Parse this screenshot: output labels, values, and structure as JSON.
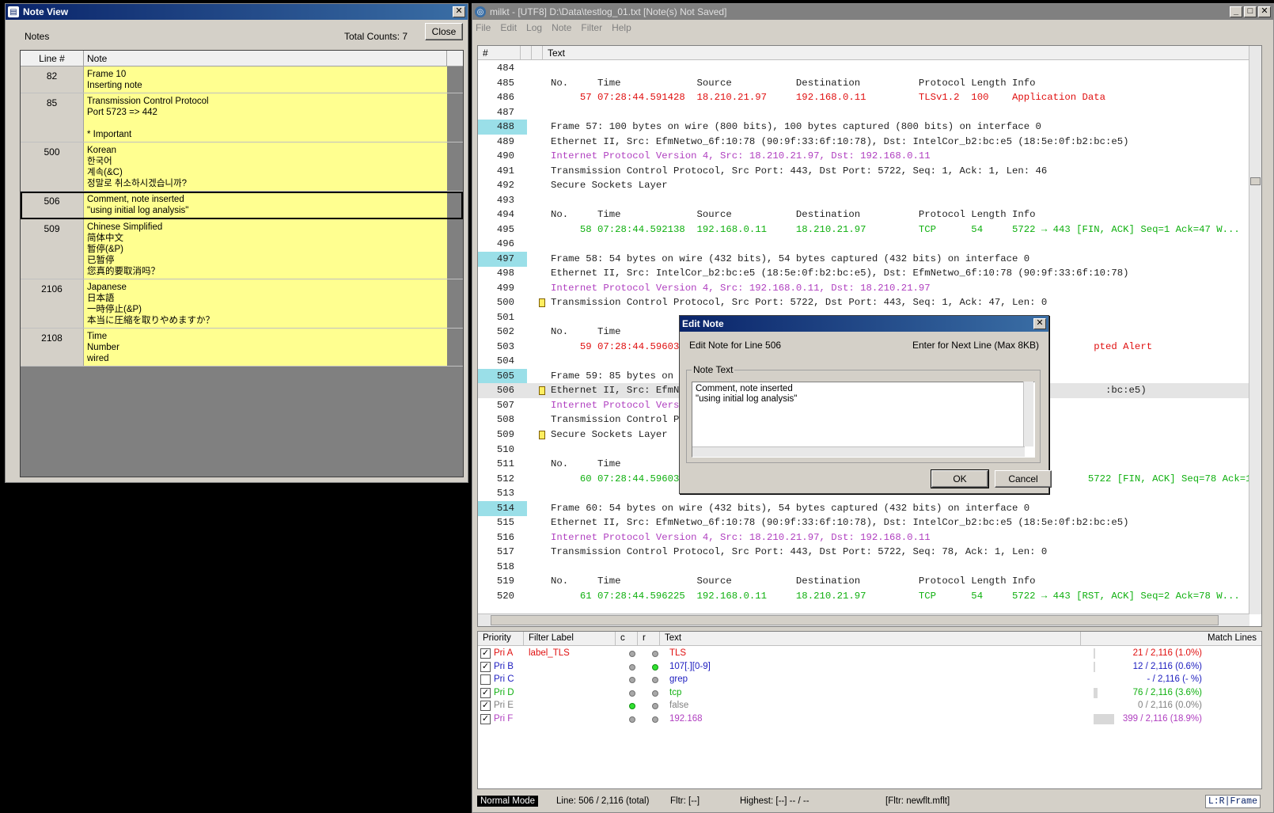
{
  "noteview": {
    "title": "Note View",
    "notes_label": "Notes",
    "total": "Total Counts: 7",
    "close": "Close",
    "col_line": "Line #",
    "col_note": "Note",
    "rows": [
      {
        "line": "82",
        "note": "Frame 10\nInserting note",
        "h": 34
      },
      {
        "line": "85",
        "note": "Transmission Control Protocol\nPort 5723 => 442\n\n* Important",
        "h": 62
      },
      {
        "line": "500",
        "note": "Korean\n한국어\n계속(&C)\n정말로 취소하시겠습니까?",
        "h": 62
      },
      {
        "line": "506",
        "note": "Comment, note inserted\n\"using initial log analysis\"",
        "h": 35,
        "sel": true
      },
      {
        "line": "509",
        "note": "Chinese Simplified\n简体中文\n暂停(&P)\n已暂停\n您真的要取消吗？",
        "h": 76
      },
      {
        "line": "2106",
        "note": "Japanese\n日本語\n一時停止(&P)\n本当に圧縮を取りやめますか？",
        "h": 62
      },
      {
        "line": "2108",
        "note": "Time\nNumber\nwired",
        "h": 48
      }
    ]
  },
  "main": {
    "title": "milkt - [UTF8] D:\\Data\\testlog_01.txt [Note(s) Not Saved]",
    "menu": [
      "File",
      "Edit",
      "Log",
      "Note",
      "Filter",
      "Help"
    ],
    "col_num": "#",
    "col_text": "Text",
    "lines": [
      {
        "n": "484",
        "t": "",
        "c": "blk"
      },
      {
        "n": "485",
        "t": "No.     Time             Source           Destination          Protocol Length Info",
        "c": "blk"
      },
      {
        "n": "486",
        "t": "     57 07:28:44.591428  18.210.21.97     192.168.0.11         TLSv1.2  100    Application Data",
        "c": "red"
      },
      {
        "n": "487",
        "t": "",
        "c": "blk"
      },
      {
        "n": "488",
        "t": "Frame 57: 100 bytes on wire (800 bits), 100 bytes captured (800 bits) on interface 0",
        "c": "blk",
        "bm": true
      },
      {
        "n": "489",
        "t": "Ethernet II, Src: EfmNetwo_6f:10:78 (90:9f:33:6f:10:78), Dst: IntelCor_b2:bc:e5 (18:5e:0f:b2:bc:e5)",
        "c": "blk"
      },
      {
        "n": "490",
        "t": "Internet Protocol Version 4, Src: 18.210.21.97, Dst: 192.168.0.11",
        "c": "pur"
      },
      {
        "n": "491",
        "t": "Transmission Control Protocol, Src Port: 443, Dst Port: 5722, Seq: 1, Ack: 1, Len: 46",
        "c": "blk"
      },
      {
        "n": "492",
        "t": "Secure Sockets Layer",
        "c": "blk"
      },
      {
        "n": "493",
        "t": "",
        "c": "blk"
      },
      {
        "n": "494",
        "t": "No.     Time             Source           Destination          Protocol Length Info",
        "c": "blk"
      },
      {
        "n": "495",
        "t": "     58 07:28:44.592138  192.168.0.11     18.210.21.97         TCP      54     5722 → 443 [FIN, ACK] Seq=1 Ack=47 W...",
        "c": "grn"
      },
      {
        "n": "496",
        "t": "",
        "c": "blk"
      },
      {
        "n": "497",
        "t": "Frame 58: 54 bytes on wire (432 bits), 54 bytes captured (432 bits) on interface 0",
        "c": "blk",
        "bm": true
      },
      {
        "n": "498",
        "t": "Ethernet II, Src: IntelCor_b2:bc:e5 (18:5e:0f:b2:bc:e5), Dst: EfmNetwo_6f:10:78 (90:9f:33:6f:10:78)",
        "c": "blk"
      },
      {
        "n": "499",
        "t": "Internet Protocol Version 4, Src: 192.168.0.11, Dst: 18.210.21.97",
        "c": "pur"
      },
      {
        "n": "500",
        "t": "Transmission Control Protocol, Src Port: 5722, Dst Port: 443, Seq: 1, Ack: 47, Len: 0",
        "c": "blk",
        "note": true
      },
      {
        "n": "501",
        "t": "",
        "c": "blk"
      },
      {
        "n": "502",
        "t": "No.     Time",
        "c": "blk"
      },
      {
        "n": "503",
        "t": "     59 07:28:44.596036                                                                      pted Alert",
        "c": "red"
      },
      {
        "n": "504",
        "t": "",
        "c": "blk"
      },
      {
        "n": "505",
        "t": "Frame 59: 85 bytes on wi",
        "c": "blk",
        "bm": true
      },
      {
        "n": "506",
        "t": "Ethernet II, Src: EfmNet                                                                       :bc:e5)",
        "c": "blk",
        "note": true,
        "cur": true
      },
      {
        "n": "507",
        "t": "Internet Protocol Versio",
        "c": "pur"
      },
      {
        "n": "508",
        "t": "Transmission Control Pro",
        "c": "blk"
      },
      {
        "n": "509",
        "t": "Secure Sockets Layer",
        "c": "blk",
        "note": true
      },
      {
        "n": "510",
        "t": "",
        "c": "blk"
      },
      {
        "n": "511",
        "t": "No.     Time",
        "c": "blk"
      },
      {
        "n": "512",
        "t": "     60 07:28:44.596038                                                                     5722 [FIN, ACK] Seq=78 Ack=1 W...",
        "c": "grn"
      },
      {
        "n": "513",
        "t": "",
        "c": "blk"
      },
      {
        "n": "514",
        "t": "Frame 60: 54 bytes on wire (432 bits), 54 bytes captured (432 bits) on interface 0",
        "c": "blk",
        "bm": true
      },
      {
        "n": "515",
        "t": "Ethernet II, Src: EfmNetwo_6f:10:78 (90:9f:33:6f:10:78), Dst: IntelCor_b2:bc:e5 (18:5e:0f:b2:bc:e5)",
        "c": "blk"
      },
      {
        "n": "516",
        "t": "Internet Protocol Version 4, Src: 18.210.21.97, Dst: 192.168.0.11",
        "c": "pur"
      },
      {
        "n": "517",
        "t": "Transmission Control Protocol, Src Port: 443, Dst Port: 5722, Seq: 78, Ack: 1, Len: 0",
        "c": "blk"
      },
      {
        "n": "518",
        "t": "",
        "c": "blk"
      },
      {
        "n": "519",
        "t": "No.     Time             Source           Destination          Protocol Length Info",
        "c": "blk"
      },
      {
        "n": "520",
        "t": "     61 07:28:44.596225  192.168.0.11     18.210.21.97         TCP      54     5722 → 443 [RST, ACK] Seq=2 Ack=78 W...",
        "c": "grn"
      }
    ],
    "filter_headers": [
      "Priority",
      "Filter Label",
      "c",
      "r",
      "Text",
      "Match Lines"
    ],
    "filters": [
      {
        "pri": "Pri A",
        "label": "label_TLS",
        "text": "TLS",
        "match": "21 / 2,116 (1.0%)",
        "color": "#e01010",
        "checked": true,
        "c": false,
        "r": false,
        "bar": 0.01
      },
      {
        "pri": "Pri B",
        "label": "",
        "text": "107[.][0-9]",
        "match": "12 / 2,116 (0.6%)",
        "color": "#2020c0",
        "checked": true,
        "c": false,
        "r": true,
        "bar": 0.006
      },
      {
        "pri": "Pri C",
        "label": "",
        "text": "grep",
        "match": "- / 2,116 (- %)",
        "color": "#2020c0",
        "checked": false,
        "c": false,
        "r": false,
        "bar": 0
      },
      {
        "pri": "Pri D",
        "label": "",
        "text": "tcp",
        "match": "76 / 2,116 (3.6%)",
        "color": "#10b010",
        "checked": true,
        "c": false,
        "r": false,
        "bar": 0.036
      },
      {
        "pri": "Pri E",
        "label": "",
        "text": "false",
        "match": "0 / 2,116 (0.0%)",
        "color": "#808080",
        "checked": true,
        "c": true,
        "r": false,
        "bar": 0
      },
      {
        "pri": "Pri F",
        "label": "",
        "text": "192.168",
        "match": "399 / 2,116 (18.9%)",
        "color": "#b040c0",
        "checked": true,
        "c": false,
        "r": false,
        "bar": 0.189
      }
    ],
    "status": {
      "mode": "Normal Mode",
      "line": "Line: 506 / 2,116 (total)",
      "fltr": "Fltr: [--]",
      "highest": "Highest: [--] -- / --",
      "file": "[Fltr: newflt.mflt]",
      "right": "L:R|Frame"
    }
  },
  "edit": {
    "title": "Edit Note",
    "subtitle": "Edit Note for Line 506",
    "hint": "Enter for Next Line (Max 8KB)",
    "group": "Note Text",
    "text": "Comment, note inserted\n\"using initial log analysis\"",
    "ok": "OK",
    "cancel": "Cancel"
  }
}
